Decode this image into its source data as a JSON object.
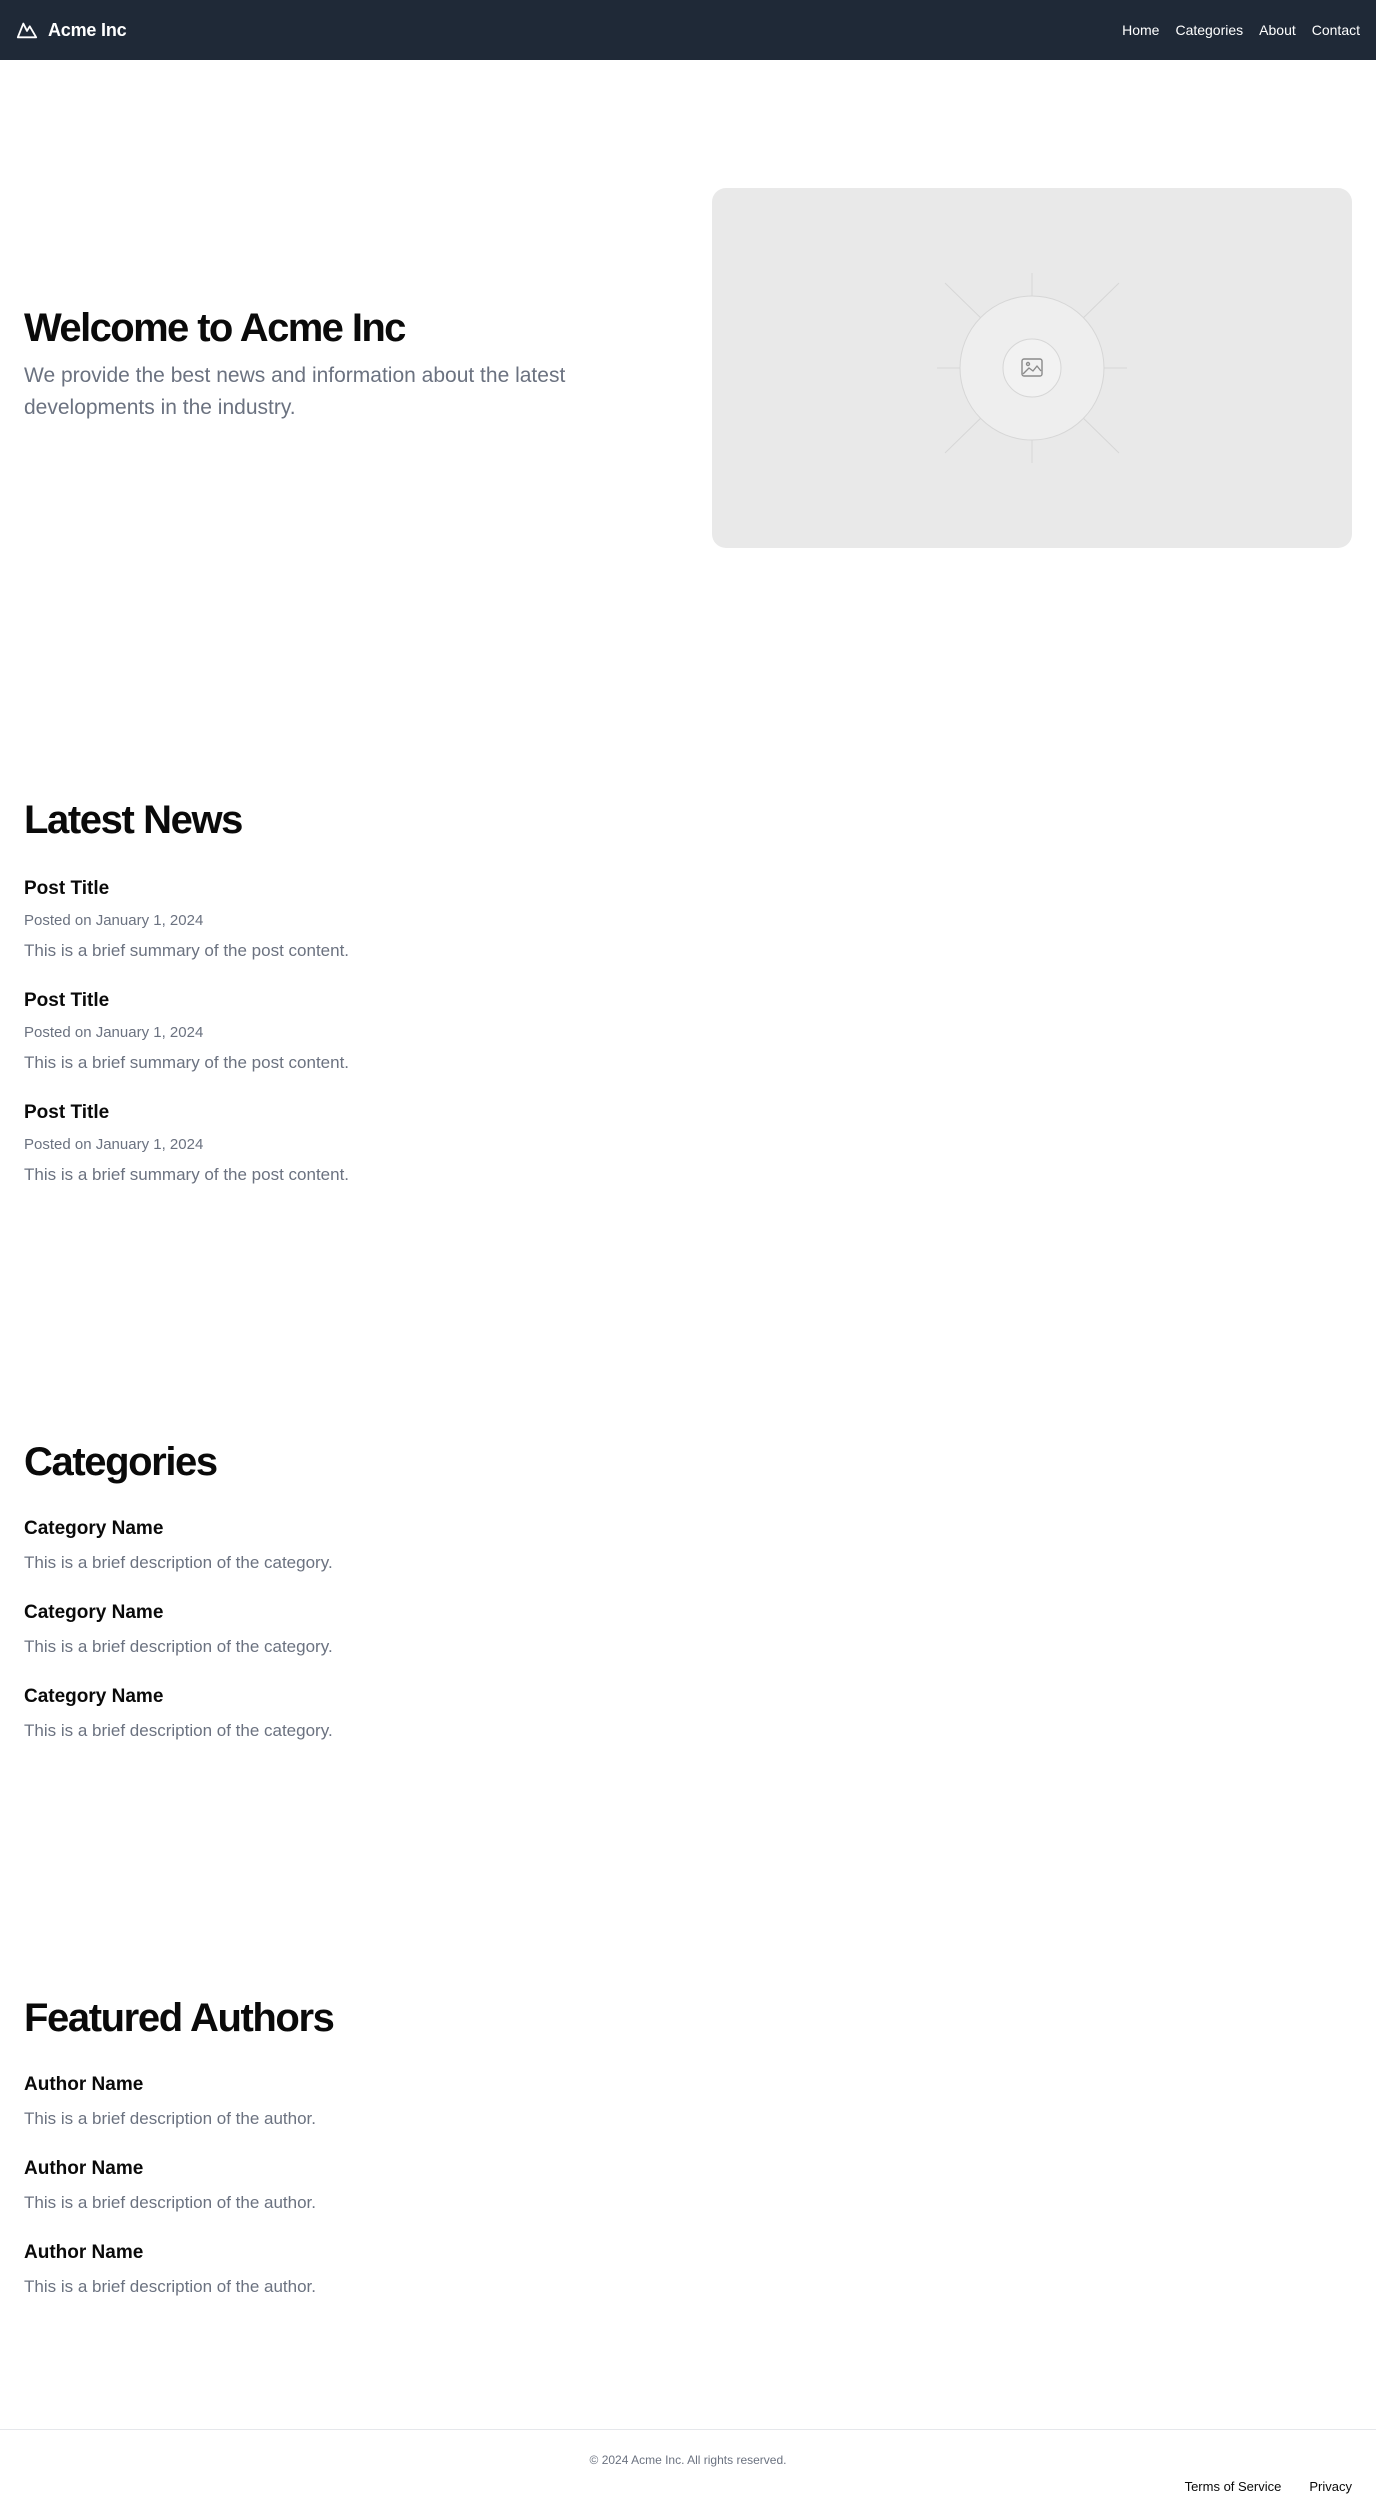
{
  "header": {
    "brand_name": "Acme Inc",
    "brand_icon": "mountain-icon",
    "nav": [
      "Home",
      "Categories",
      "About",
      "Contact"
    ]
  },
  "hero": {
    "title": "Welcome to Acme Inc",
    "subtitle": "We provide the best news and information about the latest developments in the industry.",
    "image_icon": "image-placeholder-icon"
  },
  "latest_news": {
    "title": "Latest News",
    "posts": [
      {
        "title": "Post Title",
        "meta": "Posted on January 1, 2024",
        "summary": "This is a brief summary of the post content."
      },
      {
        "title": "Post Title",
        "meta": "Posted on January 1, 2024",
        "summary": "This is a brief summary of the post content."
      },
      {
        "title": "Post Title",
        "meta": "Posted on January 1, 2024",
        "summary": "This is a brief summary of the post content."
      }
    ]
  },
  "categories": {
    "title": "Categories",
    "items": [
      {
        "name": "Category Name",
        "description": "This is a brief description of the category."
      },
      {
        "name": "Category Name",
        "description": "This is a brief description of the category."
      },
      {
        "name": "Category Name",
        "description": "This is a brief description of the category."
      }
    ]
  },
  "authors": {
    "title": "Featured Authors",
    "items": [
      {
        "name": "Author Name",
        "description": "This is a brief description of the author."
      },
      {
        "name": "Author Name",
        "description": "This is a brief description of the author."
      },
      {
        "name": "Author Name",
        "description": "This is a brief description of the author."
      }
    ]
  },
  "footer": {
    "copyright": "© 2024 Acme Inc. All rights reserved.",
    "links": [
      "Terms of Service",
      "Privacy"
    ]
  },
  "colors": {
    "header_bg": "#1f2937",
    "muted_text": "#6b7280",
    "placeholder_bg": "#e9e9e9"
  }
}
